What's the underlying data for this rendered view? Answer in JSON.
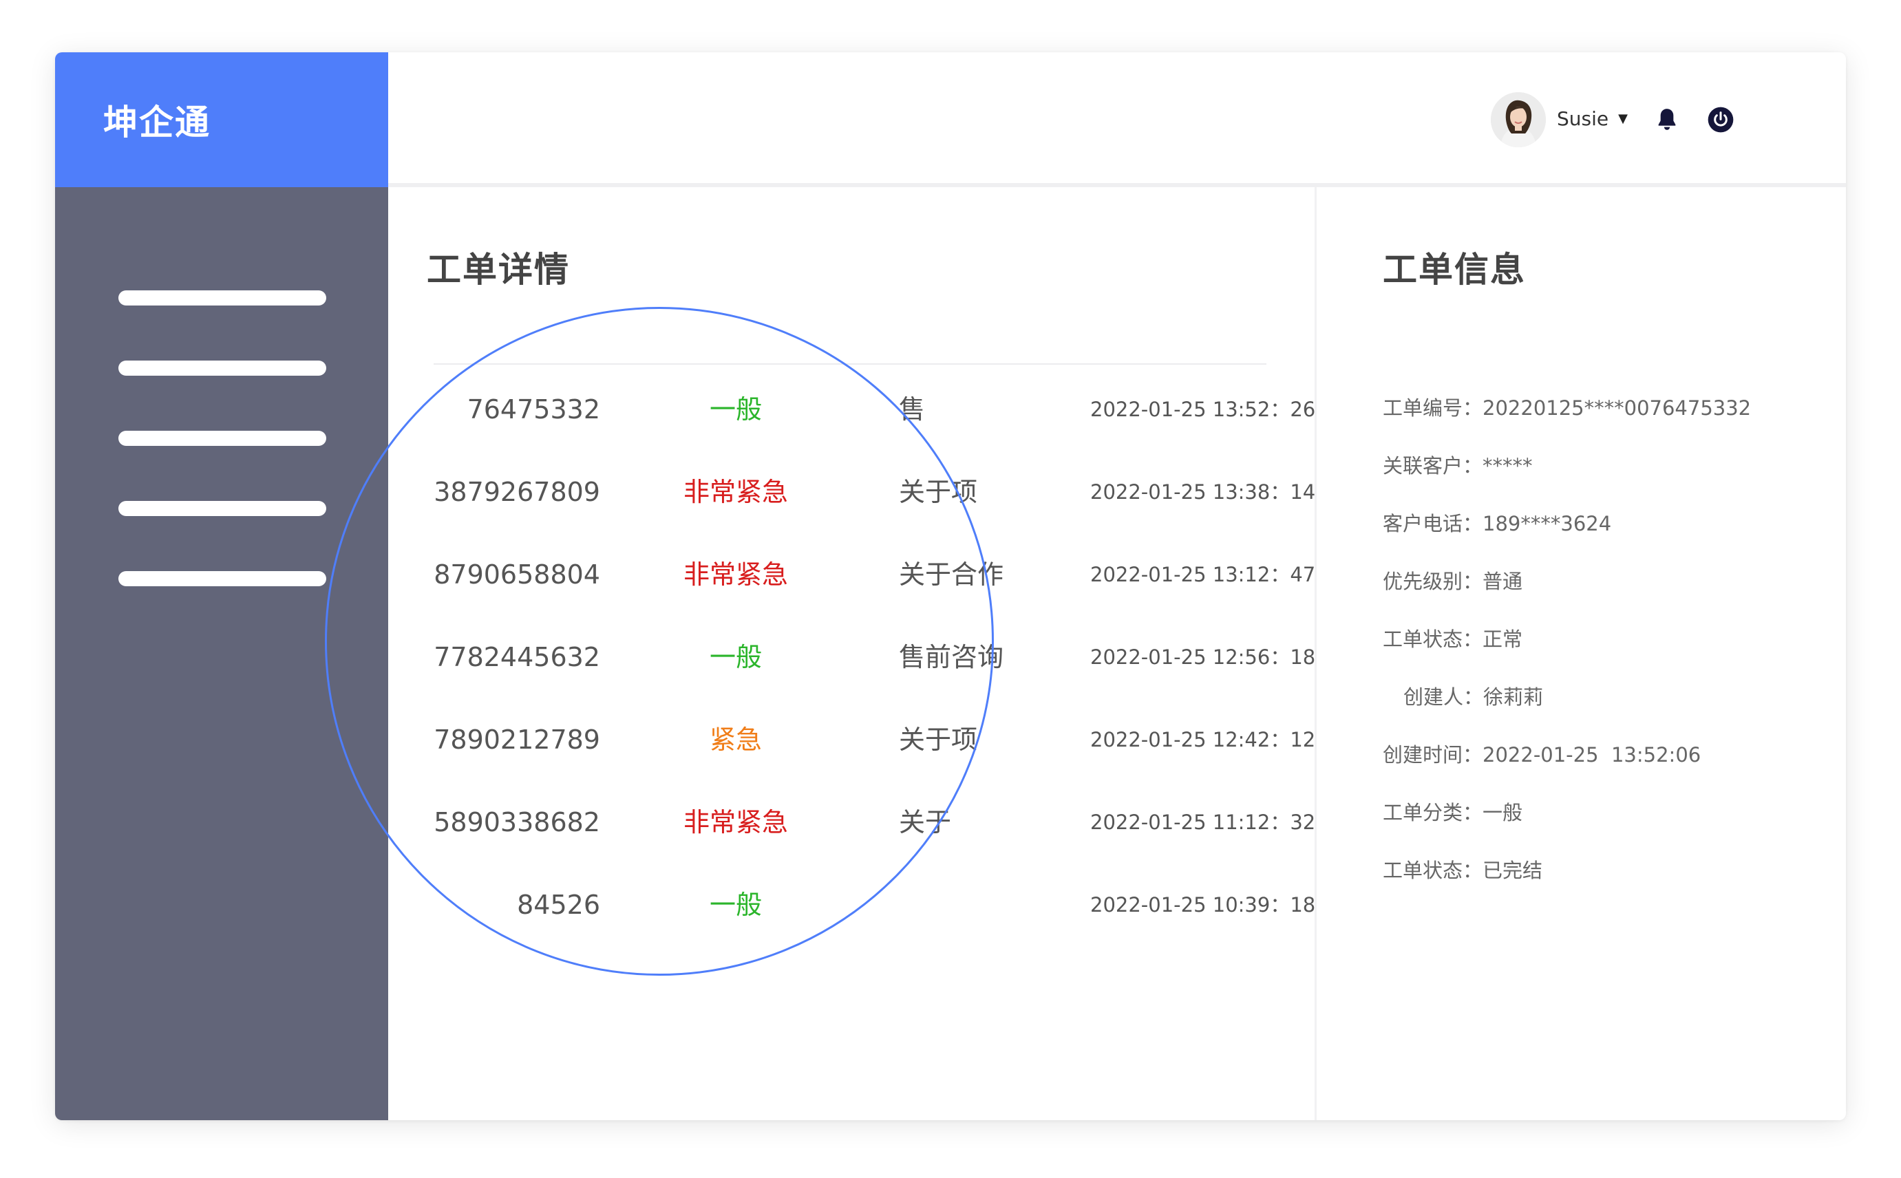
{
  "app": {
    "logo_text": "坤企通"
  },
  "sidebar": {
    "items": [
      "",
      "",
      "",
      "",
      ""
    ]
  },
  "header": {
    "user_name": "Susie"
  },
  "main": {
    "title": "工单详情",
    "rows": [
      {
        "id": "76475332",
        "priority": "一般",
        "priority_color": "#2bb52b",
        "subject": "售",
        "time": "2022-01-25 13:52：26"
      },
      {
        "id": "3879267809",
        "priority": "非常紧急",
        "priority_color": "#d81e1e",
        "subject": "关于项",
        "time": "2022-01-25 13:38：14"
      },
      {
        "id": "8790658804",
        "priority": "非常紧急",
        "priority_color": "#d81e1e",
        "subject": "关于合作",
        "time": "2022-01-25 13:12：47"
      },
      {
        "id": "7782445632",
        "priority": "一般",
        "priority_color": "#2bb52b",
        "subject": "售前咨询",
        "time": "2022-01-25 12:56：18"
      },
      {
        "id": "7890212789",
        "priority": "紧急",
        "priority_color": "#f07d18",
        "subject": "关于项",
        "time": "2022-01-25 12:42：12"
      },
      {
        "id": "5890338682",
        "priority": "非常紧急",
        "priority_color": "#d81e1e",
        "subject": "关于",
        "time": "2022-01-25 11:12：32"
      },
      {
        "id": "84526",
        "priority": "一般",
        "priority_color": "#2bb52b",
        "subject": "",
        "time": "2022-01-25 10:39：18"
      }
    ]
  },
  "info": {
    "title": "工单信息",
    "fields": [
      {
        "label": "工单编号：",
        "value": "20220125****0076475332"
      },
      {
        "label": "关联客户：",
        "value": "*****"
      },
      {
        "label": "客户电话：",
        "value": "189****3624"
      },
      {
        "label": "优先级别：",
        "value": "普通"
      },
      {
        "label": "工单状态：",
        "value": "正常"
      },
      {
        "label": "创建人：",
        "value": "徐莉莉"
      },
      {
        "label": "创建时间：",
        "value": "2022-01-25  13:52:06"
      },
      {
        "label": "工单分类：",
        "value": "一般"
      },
      {
        "label": "工单状态：",
        "value": "已完结"
      }
    ]
  },
  "colors": {
    "accent": "#4f7efa",
    "sidebar": "#626579"
  }
}
